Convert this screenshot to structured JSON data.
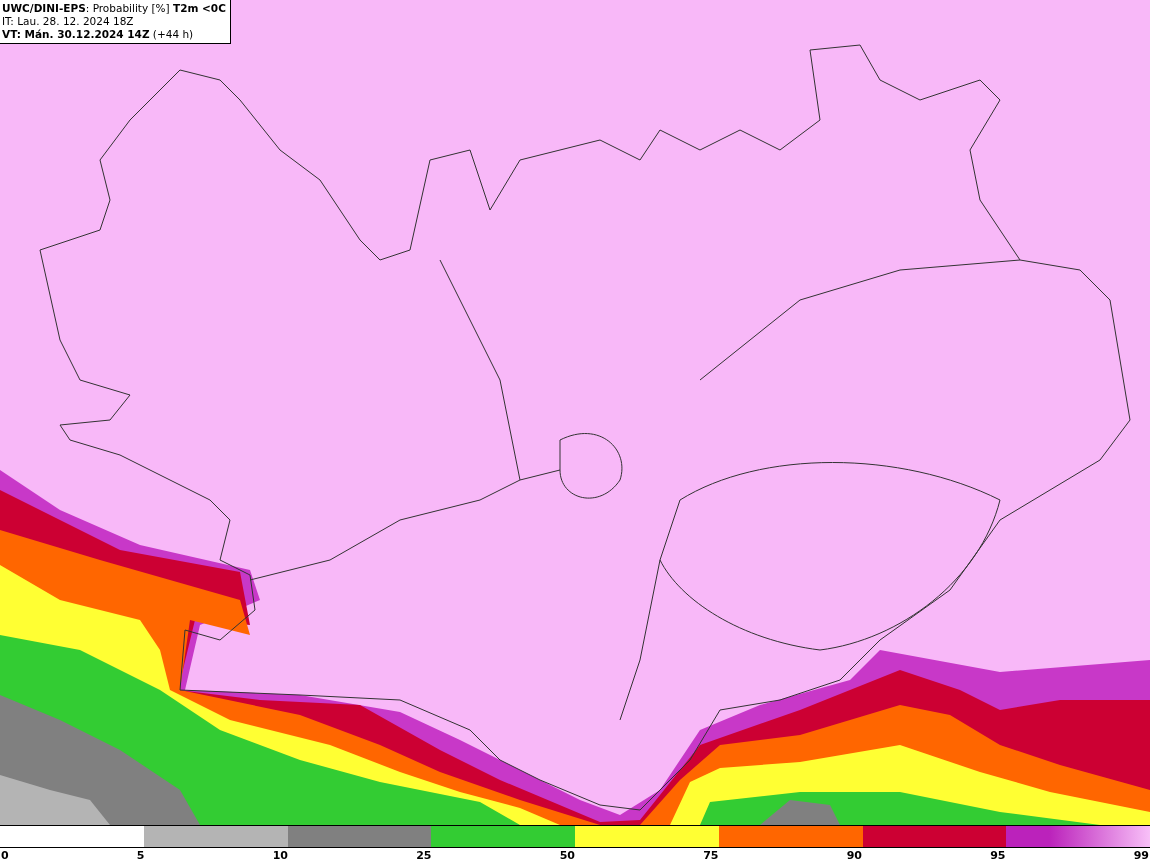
{
  "header": {
    "title": "**UWC/DINI-EPS**: Probability [%] **T2m <0C**",
    "init_time": "IT: Lau. 28. 12. 2024 18Z",
    "valid_time": "**VT: Mán. 30.12.2024 14Z** (+44 h)"
  },
  "legend": {
    "segments": [
      {
        "kind": "blank"
      },
      {
        "color": "#b4b4b4"
      },
      {
        "color": "#808080"
      },
      {
        "color": "#33cc33"
      },
      {
        "color": "#ffff33"
      },
      {
        "color": "#ff6600"
      },
      {
        "color": "#cc0033"
      },
      {
        "color": "#bb22bb",
        "kind": "gradient"
      }
    ],
    "labels": [
      "0",
      "5",
      "10",
      "25",
      "50",
      "75",
      "90",
      "95",
      "99"
    ]
  }
}
